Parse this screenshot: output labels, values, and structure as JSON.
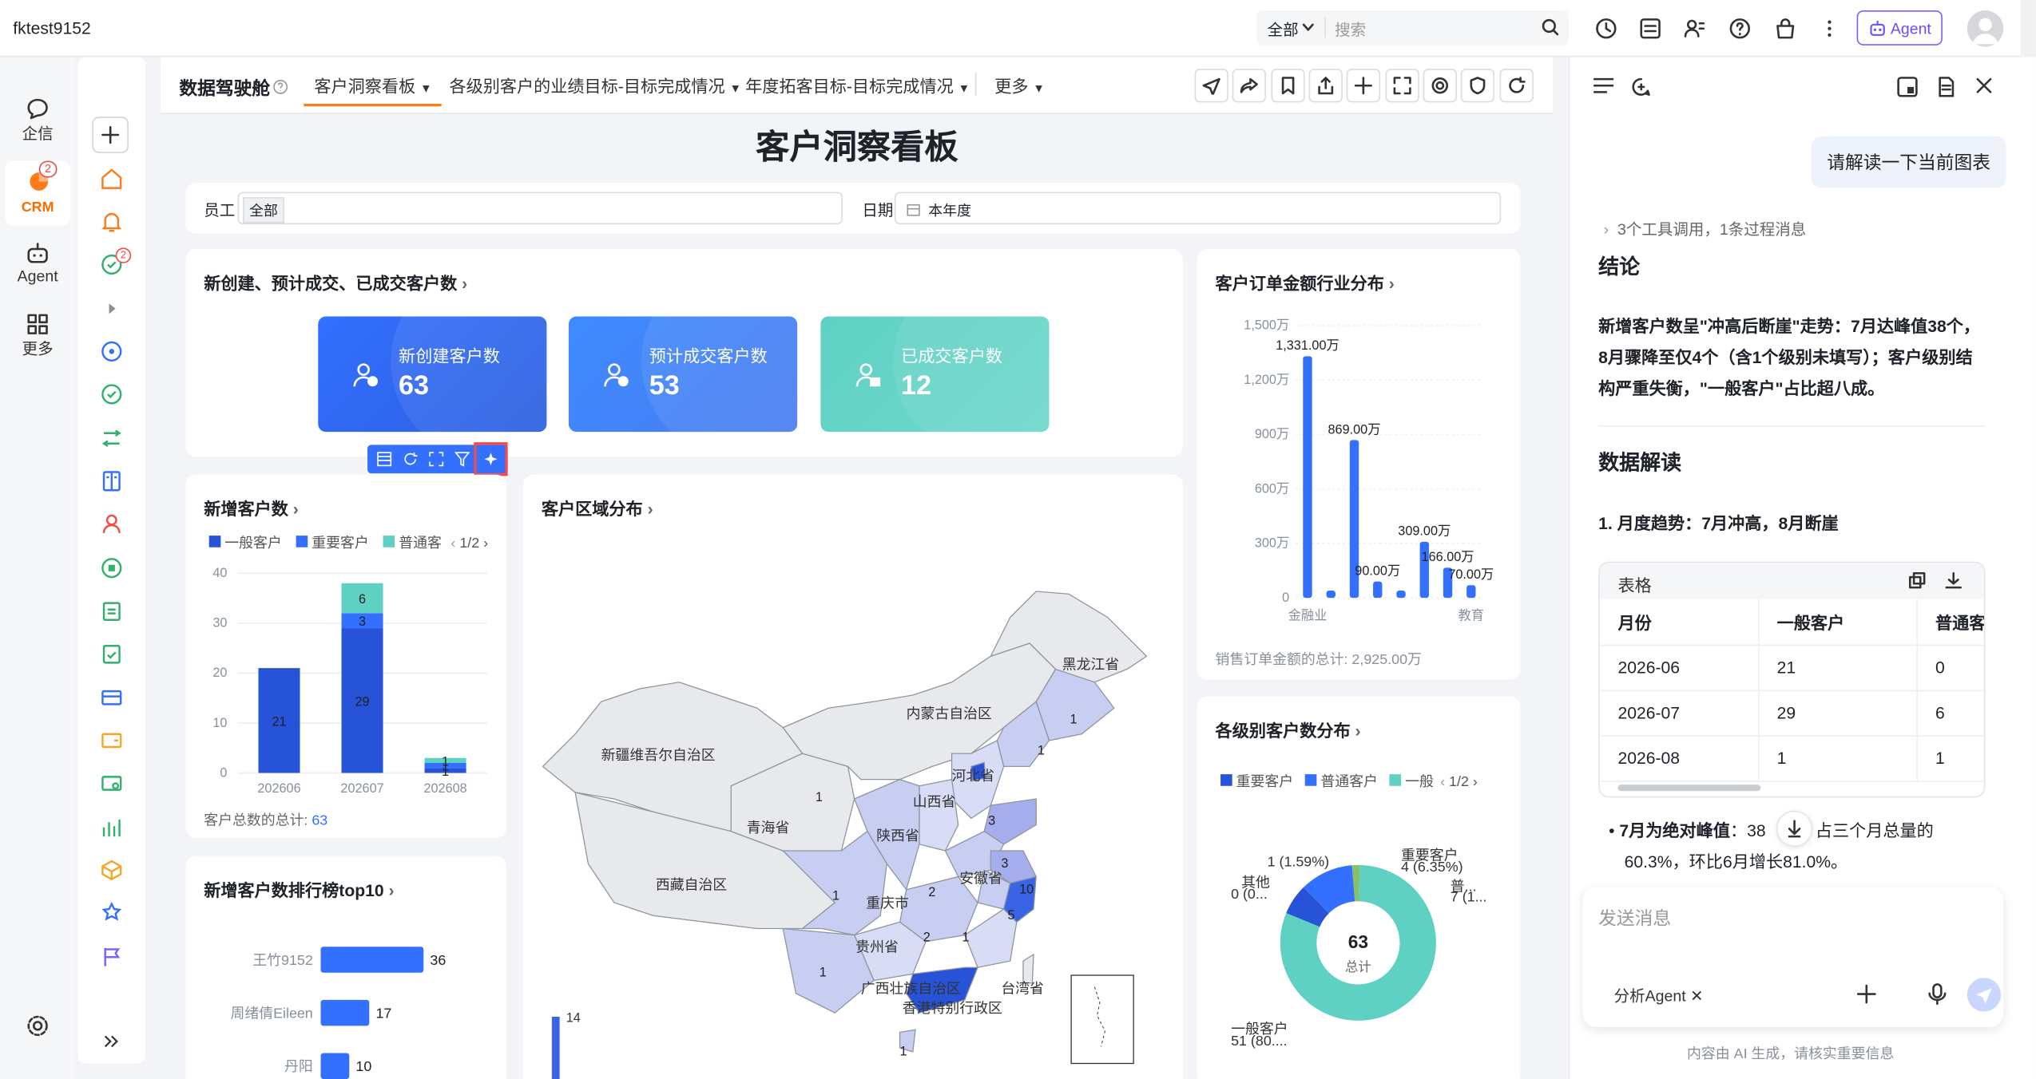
{
  "topbar": {
    "user": "fktest9152",
    "search_scope": "全部",
    "search_placeholder": "搜索",
    "agent_label": "Agent"
  },
  "leftnav": {
    "items": [
      {
        "label": "企信",
        "icon": "chat-icon"
      },
      {
        "label": "CRM",
        "icon": "crm-icon",
        "badge": "2"
      },
      {
        "label": "Agent",
        "icon": "robot-icon"
      },
      {
        "label": "更多",
        "icon": "grid-icon"
      }
    ]
  },
  "secnav": {
    "badge": "2"
  },
  "dashboard": {
    "product": "数据驾驶舱",
    "tabs": [
      "客户洞察看板",
      "各级别客户的业绩目标-目标完成情况",
      "年度拓客目标-目标完成情况",
      "更多"
    ],
    "title": "客户洞察看板",
    "filters": {
      "employee_label": "员工",
      "employee_value": "全部",
      "date_label": "日期",
      "date_value": "本年度"
    }
  },
  "kpi_card": {
    "title": "新创建、预计成交、已成交客户数",
    "items": [
      {
        "label": "新创建客户数",
        "value": "63",
        "color": "#3370ff"
      },
      {
        "label": "预计成交客户数",
        "value": "53",
        "color": "#3d8bff"
      },
      {
        "label": "已成交客户数",
        "value": "12",
        "color": "#5ed1c3"
      }
    ]
  },
  "new_customers": {
    "title": "新增客户数",
    "legend": [
      "一般客户",
      "重要客户",
      "普通客"
    ],
    "pager": "1/2",
    "footer_label": "客户总数的总计:",
    "footer_value": "63"
  },
  "region_map": {
    "title": "客户区域分布",
    "scale_max": "14",
    "provinces": [
      "黑龙江省",
      "内蒙古自治区",
      "新疆维吾尔自治区",
      "河北省",
      "山西省",
      "青海省",
      "陕西省",
      "西藏自治区",
      "安徽省",
      "重庆市",
      "贵州省",
      "广西壮族自治区",
      "香港特别行政区",
      "台湾省"
    ]
  },
  "industry": {
    "title": "客户订单金额行业分布",
    "footer": "销售订单金额的总计: 2,925.00万"
  },
  "levels": {
    "title": "各级别客户数分布",
    "legend": [
      "重要客户",
      "普通客户",
      "一般"
    ],
    "pager": "1/2",
    "center_value": "63",
    "center_label": "总计",
    "labels": [
      "重要客户",
      "4 (6.35%)",
      "普...",
      "7 (1...",
      "其他",
      "0 (0...",
      "1 (1.59%)",
      "一般客户",
      "51 (80...."
    ]
  },
  "ranking": {
    "title": "新增客户数排行榜top10",
    "names": [
      "王竹9152",
      "周绪倩Eileen",
      "丹阳"
    ],
    "values": [
      36,
      17,
      10
    ]
  },
  "ai_panel": {
    "user_msg": "请解读一下当前图表",
    "tool_line": "3个工具调用，1条过程消息",
    "h1": "结论",
    "conclusion": [
      "新增客户数呈\"冲高后断崖\"走势：7月达峰值38个，",
      "8月骤降至仅4个（含1个级别未填写）；客户级别结",
      "构严重失衡，\"一般客户\"占比超八成。"
    ],
    "h2": "数据解读",
    "h3": "1. 月度趋势：7月冲高，8月断崖",
    "table_label": "表格",
    "table_header": [
      "月份",
      "一般客户",
      "普通客"
    ],
    "table_rows": [
      [
        "2026-06",
        "21",
        "0"
      ],
      [
        "2026-07",
        "29",
        "6"
      ],
      [
        "2026-08",
        "1",
        "1"
      ]
    ],
    "bullet_bold": "7月为绝对峰值",
    "bullet_rest1": "：38",
    "bullet_rest2": "，占三个月总量的",
    "bullet_line2": "60.3%，环比6月增长81.0%。",
    "input_placeholder": "发送消息",
    "agent_chip": "分析Agent",
    "disclaimer": "内容由 AI 生成，请核实重要信息"
  },
  "chart_data": [
    {
      "type": "bar",
      "title": "新增客户数",
      "categories": [
        "202606",
        "202607",
        "202608"
      ],
      "series": [
        {
          "name": "一般客户",
          "values": [
            21,
            29,
            1
          ]
        },
        {
          "name": "重要客户",
          "values": [
            0,
            3,
            1
          ]
        },
        {
          "name": "普通客",
          "values": [
            0,
            6,
            1
          ]
        }
      ],
      "ylim": [
        0,
        40
      ],
      "yticks": [
        0,
        10,
        20,
        30,
        40
      ],
      "stacked": true,
      "legend": "top"
    },
    {
      "type": "bar",
      "title": "客户订单金额行业分布",
      "categories": [
        "金融业",
        "",
        "",
        "",
        "",
        "",
        "",
        "教育"
      ],
      "values": [
        1331,
        40,
        869,
        90,
        40,
        309,
        166,
        70
      ],
      "data_labels": [
        "1,331.00万",
        "",
        "869.00万",
        "90.00万",
        "",
        "309.00万",
        "166.00万",
        "70.00万"
      ],
      "yticks": [
        "0",
        "300万",
        "600万",
        "900万",
        "1,200万",
        "1,500万"
      ],
      "ylim": [
        0,
        1500
      ]
    },
    {
      "type": "pie",
      "title": "各级别客户数分布",
      "labels": [
        "一般客户",
        "重要客户",
        "普通客户",
        "其他",
        "未填写"
      ],
      "values": [
        51,
        4,
        7,
        0,
        1
      ],
      "total": 63
    },
    {
      "type": "bar",
      "title": "新增客户数排行榜top10",
      "orientation": "horizontal",
      "categories": [
        "王竹9152",
        "周绪倩Eileen",
        "丹阳"
      ],
      "values": [
        36,
        17,
        10
      ]
    }
  ]
}
